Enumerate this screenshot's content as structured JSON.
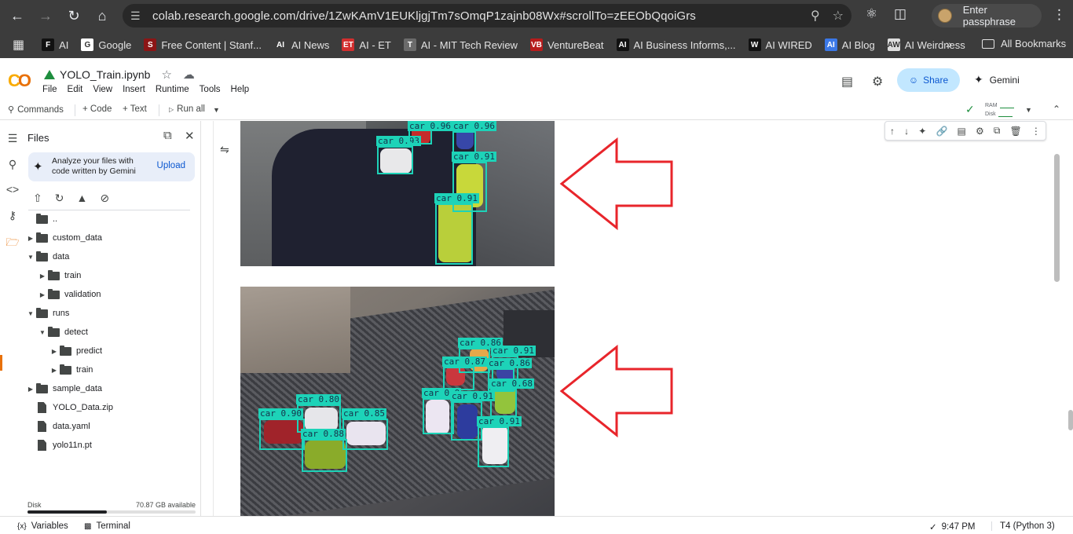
{
  "browser": {
    "url": "colab.research.google.com/drive/1ZwKAmV1EUKljgjTm7sOmqP1zajnb08Wx#scrollTo=zEEObQqoiGrs",
    "profile_label": "Enter passphrase",
    "bookmarks": [
      {
        "label": "AI",
        "icon": "F",
        "color": "#111111"
      },
      {
        "label": "Google",
        "icon": "G",
        "color": "#ffffff"
      },
      {
        "label": "Free Content | Stanf...",
        "icon": "S",
        "color": "#8c1515"
      },
      {
        "label": "AI News",
        "icon": "AI",
        "color": "#3c3c3c"
      },
      {
        "label": "AI - ET",
        "icon": "ET",
        "color": "#d32f2f"
      },
      {
        "label": "AI - MIT Tech Review",
        "icon": "T",
        "color": "#6b6b6b"
      },
      {
        "label": "VentureBeat",
        "icon": "VB",
        "color": "#b71c1c"
      },
      {
        "label": "AI Business Informs,...",
        "icon": "AI",
        "color": "#111111"
      },
      {
        "label": "AI WIRED",
        "icon": "W",
        "color": "#111111"
      },
      {
        "label": "AI Blog",
        "icon": "AI",
        "color": "#3b78e7"
      },
      {
        "label": "AI Weirdness",
        "icon": "AW",
        "color": "#dddddd"
      }
    ],
    "all_bookmarks": "All Bookmarks"
  },
  "colab": {
    "notebook_title": "YOLO_Train.ipynb",
    "menus": [
      "File",
      "Edit",
      "View",
      "Insert",
      "Runtime",
      "Tools",
      "Help"
    ],
    "share_label": "Share",
    "gemini_label": "Gemini",
    "toolbar": {
      "commands": "Commands",
      "code": "+ Code",
      "text": "+ Text",
      "run_all": "Run all",
      "ram": "RAM",
      "disk": "Disk"
    }
  },
  "files_panel": {
    "title": "Files",
    "gemini_card": {
      "line1": "Analyze your files with",
      "line2": "code written by Gemini",
      "upload": "Upload"
    },
    "tree": [
      {
        "label": "..",
        "depth": 0,
        "type": "folder",
        "expandable": false
      },
      {
        "label": "custom_data",
        "depth": 0,
        "type": "folder",
        "expandable": true,
        "open": false
      },
      {
        "label": "data",
        "depth": 0,
        "type": "folder",
        "expandable": true,
        "open": true
      },
      {
        "label": "train",
        "depth": 1,
        "type": "folder",
        "expandable": true,
        "open": false
      },
      {
        "label": "validation",
        "depth": 1,
        "type": "folder",
        "expandable": true,
        "open": false
      },
      {
        "label": "runs",
        "depth": 0,
        "type": "folder",
        "expandable": true,
        "open": true
      },
      {
        "label": "detect",
        "depth": 1,
        "type": "folder",
        "expandable": true,
        "open": true
      },
      {
        "label": "predict",
        "depth": 2,
        "type": "folder",
        "expandable": true,
        "open": false
      },
      {
        "label": "train",
        "depth": 2,
        "type": "folder",
        "expandable": true,
        "open": false
      },
      {
        "label": "sample_data",
        "depth": 0,
        "type": "folder",
        "expandable": true,
        "open": false
      },
      {
        "label": "YOLO_Data.zip",
        "depth": 0,
        "type": "file"
      },
      {
        "label": "data.yaml",
        "depth": 0,
        "type": "file"
      },
      {
        "label": "yolo11n.pt",
        "depth": 0,
        "type": "file"
      }
    ],
    "disk_label": "Disk",
    "disk_available": "70.87 GB available",
    "disk_used_fraction": 0.47
  },
  "output": {
    "image1_detections": [
      {
        "label": "car 0.93"
      },
      {
        "label": "car 0.96"
      },
      {
        "label": "car 0.91"
      },
      {
        "label": "car 0.91"
      },
      {
        "label": "car 0.96"
      }
    ],
    "image2_detections": [
      {
        "label": "car 0.86"
      },
      {
        "label": "car 0.91"
      },
      {
        "label": "car 0.87"
      },
      {
        "label": "car 0.86"
      },
      {
        "label": "car 0.68"
      },
      {
        "label": "car 0.9"
      },
      {
        "label": "car 0.91"
      },
      {
        "label": "car 0.91"
      },
      {
        "label": "car 0.80"
      },
      {
        "label": "car 0.90"
      },
      {
        "label": "car 0.85"
      },
      {
        "label": "car 0.88"
      }
    ],
    "annotation_color": "#e8252b",
    "box_color": "#1dd3b8"
  },
  "status": {
    "variables": "Variables",
    "terminal": "Terminal",
    "time": "9:47 PM",
    "runtime": "T4 (Python 3)"
  }
}
